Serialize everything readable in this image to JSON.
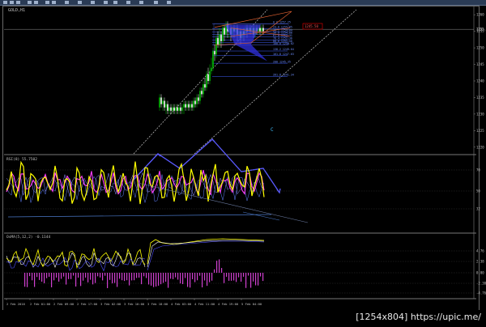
{
  "window": {
    "title": "GOLD,H1"
  },
  "main": {
    "price_tag": "1245.50",
    "current_price": "1255.60",
    "price_ticks": [
      "1260",
      "1255",
      "1250",
      "1245",
      "1240",
      "1235",
      "1230",
      "1225",
      "1220"
    ],
    "fib_levels": [
      {
        "label": "0.0  1257.25",
        "level": 1257.25
      },
      {
        "label": "23.6  1255.85",
        "level": 1255.85
      },
      {
        "label": "38.2  1254.84",
        "level": 1254.84
      },
      {
        "label": "50.0  1254.08",
        "level": 1254.08
      },
      {
        "label": "61.8  1253.31",
        "level": 1253.31
      },
      {
        "label": "76.4  1252.36",
        "level": 1252.36
      },
      {
        "label": "88.6  1251.58",
        "level": 1251.58
      },
      {
        "label": "100.0  1250.82",
        "level": 1250.82
      },
      {
        "label": "138.2  1249.04",
        "level": 1249.04
      },
      {
        "label": "161.8  1247.63",
        "level": 1247.63
      },
      {
        "label": "200  1245.35",
        "level": 1245.35
      },
      {
        "label": "261.8  1241.34",
        "level": 1241.34
      }
    ],
    "wave_label": "C"
  },
  "rsi": {
    "title": "RSI(8) 55.7502",
    "ticks": [
      "70",
      "50",
      "32"
    ]
  },
  "osma": {
    "title": "OsMA(5,12,2) -0.1144",
    "ticks": [
      "4.76",
      "2.38",
      "0.00",
      "-2.38",
      "-4.76"
    ]
  },
  "time_axis": {
    "labels": [
      "2 Feb 2016",
      "2 Feb 01:00",
      "2 Feb 09:00",
      "2 Feb 17:00",
      "3 Feb 02:00",
      "3 Feb 10:00",
      "3 Feb 18:00",
      "4 Feb 03:00",
      "4 Feb 11:00",
      "4 Feb 19:00",
      "5 Feb 04:00"
    ]
  },
  "footer": {
    "stamp": "[1254x804] https://upic.me/"
  },
  "colors": {
    "background": "#000000",
    "bull_candle": "#00c000",
    "bear_candle": "#ffffff",
    "fib": "#4060ff",
    "channel": "#c8c8c8",
    "triangle": "#e06030",
    "projection": "#3030ff",
    "rsi_fast": "#ffff00",
    "rsi_slow": "#ff40ff",
    "osma_hist": "#d040d0",
    "price_tag": "#cc0000"
  }
}
